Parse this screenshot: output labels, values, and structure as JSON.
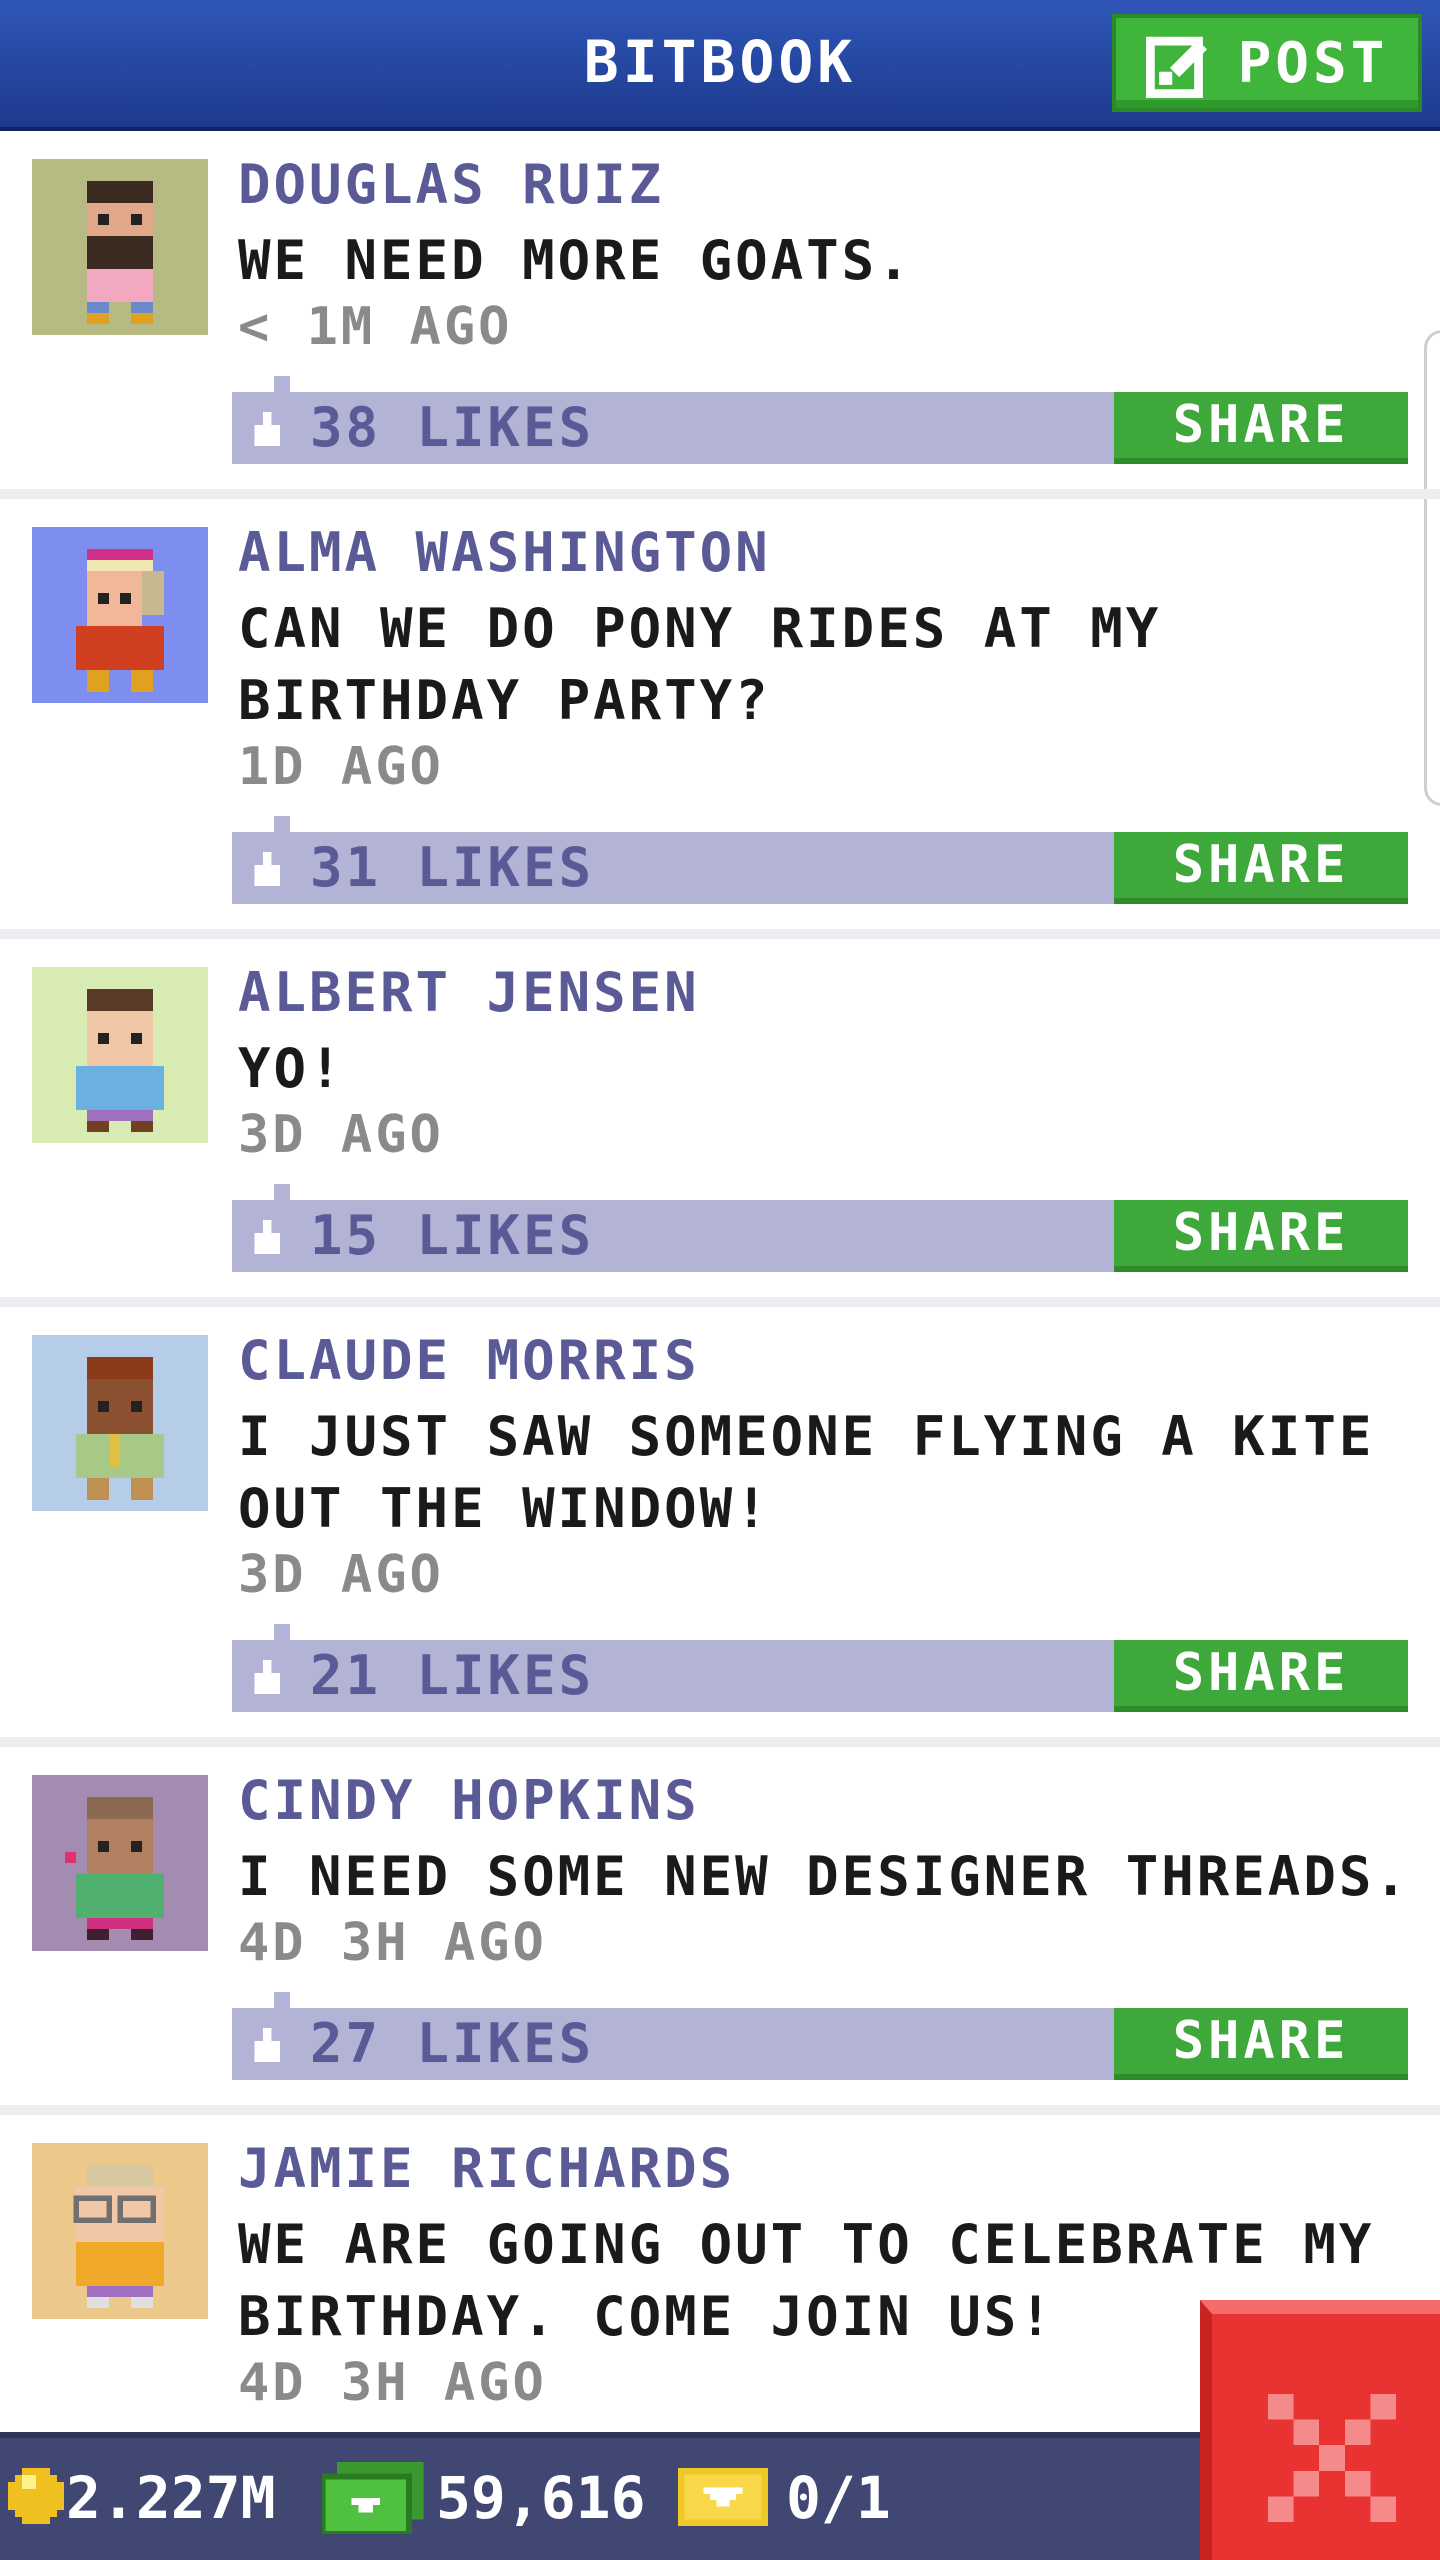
{
  "header": {
    "title": "BITBOOK",
    "post_label": "POST"
  },
  "posts": [
    {
      "author": "DOUGLAS RUIZ",
      "message": "WE NEED MORE GOATS.",
      "time": "< 1M AGO",
      "likes": "38 LIKES",
      "share": "SHARE",
      "avatar_bg": "#b8ba83"
    },
    {
      "author": "ALMA WASHINGTON",
      "message": "CAN WE DO PONY RIDES AT MY BIRTHDAY PARTY?",
      "time": "1D AGO",
      "likes": "31 LIKES",
      "share": "SHARE",
      "avatar_bg": "#7e8ef0"
    },
    {
      "author": "ALBERT JENSEN",
      "message": "YO!",
      "time": "3D AGO",
      "likes": "15 LIKES",
      "share": "SHARE",
      "avatar_bg": "#d8ebb2"
    },
    {
      "author": "CLAUDE MORRIS",
      "message": "I JUST SAW SOMEONE FLYING A KITE OUT THE WINDOW!",
      "time": "3D AGO",
      "likes": "21 LIKES",
      "share": "SHARE",
      "avatar_bg": "#b5cde8"
    },
    {
      "author": "CINDY HOPKINS",
      "message": "I NEED SOME NEW DESIGNER THREADS.",
      "time": "4D 3H AGO",
      "likes": "27 LIKES",
      "share": "SHARE",
      "avatar_bg": "#a48bb0"
    },
    {
      "author": "JAMIE RICHARDS",
      "message": "WE ARE GOING OUT TO CELEBRATE MY BIRTHDAY. COME JOIN US!",
      "time": "4D 3H AGO",
      "avatar_bg": "#ecc98a"
    }
  ],
  "status_bar": {
    "coins": "2.227M",
    "bux": "59,616",
    "tickets": "0/1"
  },
  "colors": {
    "header": "#2a4aa8",
    "post_button": "#3fb53b",
    "likes_bar": "#b3b3d6",
    "share": "#3fa83a",
    "close": "#e93232",
    "status_bar": "#414773"
  },
  "icons": [
    "edit-icon",
    "thumbs-up-icon",
    "coin-icon",
    "cash-icon",
    "ticket-icon",
    "close-icon"
  ]
}
